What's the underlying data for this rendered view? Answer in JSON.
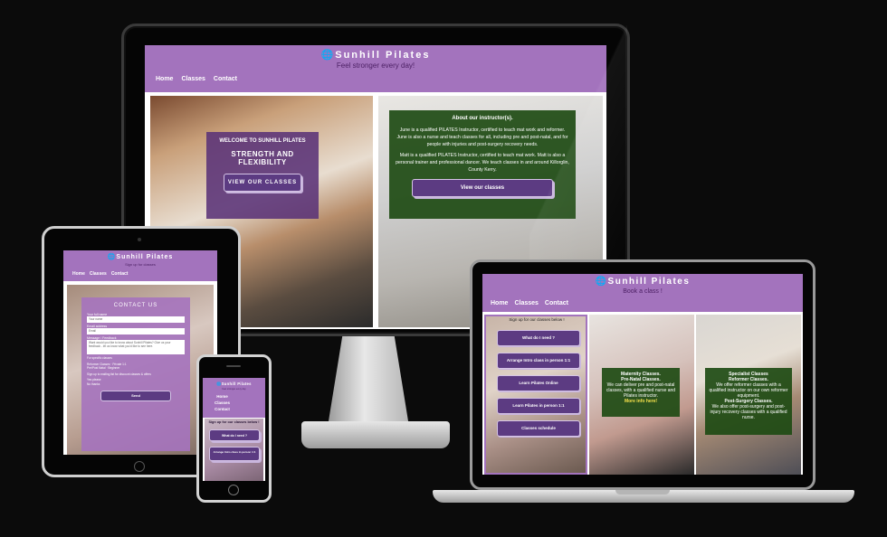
{
  "site": {
    "brand": "Sunhill Pilates",
    "globe_icon": "globe-icon"
  },
  "desktop": {
    "tagline": "Feel stronger every day!",
    "nav": [
      "Home",
      "Classes",
      "Contact"
    ],
    "welcome": {
      "line1": "WELCOME TO SUNHILL PILATES",
      "line2": "STRENGTH AND FLEXIBILITY",
      "button": "VIEW OUR CLASSES"
    },
    "about": {
      "title": "About our instructor(s).",
      "p1": "June is a qualified PILATES Instructor, certified to teach mat work and reformer. June is also a nurse and teach classes for all, including pre and post-natal, and for people with injuries and post-surgery recovery needs.",
      "p2": "Matt is a qualified PILATES Instructor, certified to teach mat work. Matt is also a personal trainer and professional dancer. We teach classes in and around Killorglin, County Kerry.",
      "button": "View our classes"
    }
  },
  "tablet": {
    "tagline": "Sign up for classes",
    "nav": [
      "Home",
      "Classes",
      "Contact"
    ],
    "form": {
      "heading": "CONTACT US",
      "name_label": "Your full name",
      "name_value": "Your name",
      "email_label": "Email address",
      "email_value": "Email",
      "message_label": "Message / Feedback",
      "message_value": "Want would you like to know about Sunhill Pilates? Give us your feedback - let us know what you'd like to see here.",
      "specify_label": "For specific classes",
      "opt1": "Reformer Classes",
      "opt2": "Private 1:1",
      "opt3": "Pre/Post Natal",
      "opt4": "Beginner",
      "signup_label": "Sign up to mailing list for discount classes & offers",
      "yes_label": "Yes please",
      "no_label": "No thanks",
      "send_button": "Send"
    }
  },
  "phone": {
    "tagline": "Feel stronger every day",
    "nav": [
      "Home",
      "Classes",
      "Contact"
    ],
    "heading": "Sign up for our classes below !",
    "btn1": "What do I need ?",
    "btn2": "Arrange Intro class in person 1:1"
  },
  "laptop": {
    "tagline": "Book a class !",
    "nav": [
      "Home",
      "Classes",
      "Contact"
    ],
    "signup": "Sign up for our classes below !",
    "buttons": [
      "What do I need ?",
      "Arrange Intro class in person 1:1",
      "Learn Pilates Online",
      "Learn Pilates in person 1:1",
      "Classes schedule"
    ],
    "maternity": {
      "title": "Maternity Classes.",
      "subtitle": "Pre-Natal Classes.",
      "body": "We can deliver pre and post-natal classes, with a qualified nurse and Pilates instructor.",
      "link": "More info here!"
    },
    "specialist": {
      "title": "Specialist Classes",
      "subtitle": "Reformer Classes.",
      "body": "We offer reformer classes with a qualified instructor on our own reformer equipment.",
      "subtitle2": "Post-Surgery Classes.",
      "body2": "We also offer post-surgery and post-injury recovery classes with a qualified nurse."
    }
  },
  "colors": {
    "background": "#0b0b0b",
    "header_purple": "#a373bd",
    "card_purple": "#5a3278",
    "card_green": "#1e4b14",
    "tagline_purple": "#4b1f63"
  }
}
